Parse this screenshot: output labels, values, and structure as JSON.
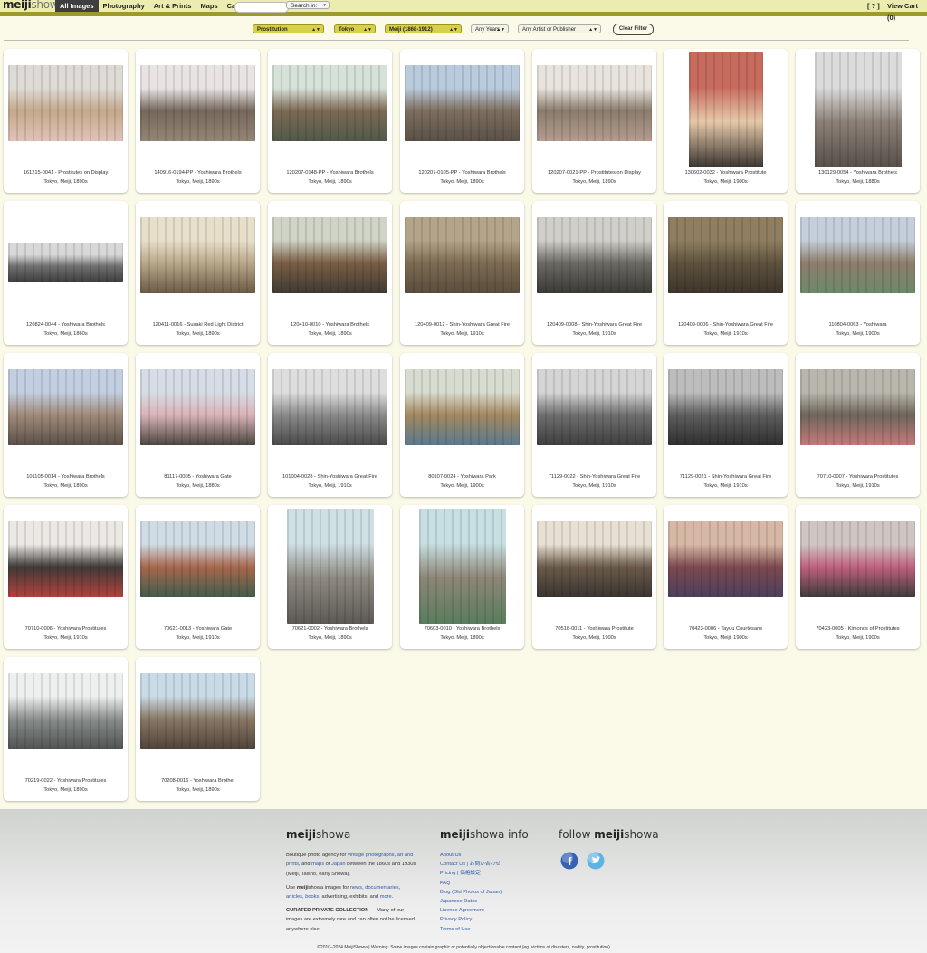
{
  "header": {
    "logo_part1": "meiji",
    "logo_part2": "showa",
    "nav": [
      "All Images",
      "Photography",
      "Art & Prints",
      "Maps",
      "Calendar"
    ],
    "search_placeholder": "",
    "search_button": "Search in:",
    "help": "[ ? ]",
    "cart": "View Cart (0)"
  },
  "filters": {
    "subject": "Prostitution",
    "place": "Tokyo",
    "era": "Meiji (1868-1912)",
    "years": "Any Years",
    "artist": "Any Artist or Publisher",
    "clear": "Clear Filter"
  },
  "images": [
    {
      "title": "161215-0041 - Prostitutes on Display",
      "sub": "Tokyo, Meiji, 1890s",
      "tone": [
        "#dedad6",
        "#c4a98b",
        "#e0c3b9"
      ]
    },
    {
      "title": "140916-0194-PP - Yoshiwara Brothels",
      "sub": "Tokyo, Meiji, 1890s",
      "tone": [
        "#e9e3e4",
        "#75685b",
        "#948675"
      ]
    },
    {
      "title": "120207-0148-PP - Yoshiwara Brothels",
      "sub": "Tokyo, Meiji, 1890s",
      "tone": [
        "#d6e1d8",
        "#7c6a53",
        "#505a4a"
      ]
    },
    {
      "title": "120207-0105-PP - Yoshiwara Brothels",
      "sub": "Tokyo, Meiji, 1890s",
      "tone": [
        "#b9cbdc",
        "#7d6e5f",
        "#595046"
      ]
    },
    {
      "title": "120207-0021-PP - Prostitutes on Display",
      "sub": "Tokyo, Meiji, 1890s",
      "tone": [
        "#e8e3dd",
        "#8a7c6c",
        "#b59c90"
      ]
    },
    {
      "title": "130602-0032 - Yoshiwara Prostitute",
      "sub": "Tokyo, Meiji, 1900s",
      "tone": [
        "#c76b5e",
        "#e6c8a8",
        "#3a3532"
      ]
    },
    {
      "title": "130129-0054 - Yoshiwara Brothels",
      "sub": "Tokyo, Meiji, 1880s",
      "tone": [
        "#dcdcdc",
        "#8c8178",
        "#575049"
      ]
    },
    {
      "title": "120824-0044 - Yoshiwara Brothels",
      "sub": "Tokyo, Meiji, 1860s",
      "tone": [
        "#d8d8d8",
        "#6f6f6f",
        "#3d3d3d"
      ]
    },
    {
      "title": "120411-0016 - Susaki Red Light District",
      "sub": "Tokyo, Meiji, 1890s",
      "tone": [
        "#e8dfcb",
        "#b9a88a",
        "#6b5a45"
      ]
    },
    {
      "title": "120410-0010 - Yoshiwara Brothels",
      "sub": "Tokyo, Meiji, 1890s",
      "tone": [
        "#cfd4c6",
        "#7a5e45",
        "#3f3a33"
      ]
    },
    {
      "title": "120409-0012 - Shin-Yoshiwara Great Fire",
      "sub": "Tokyo, Meiji, 1910s",
      "tone": [
        "#b4a58a",
        "#7d6b52",
        "#5a4d3c"
      ]
    },
    {
      "title": "120409-0008 - Shin-Yoshiwara Great Fire",
      "sub": "Tokyo, Meiji, 1910s",
      "tone": [
        "#d0cfca",
        "#6c6a64",
        "#3a3935"
      ]
    },
    {
      "title": "120409-0006 - Shin-Yoshiwara Great Fire",
      "sub": "Tokyo, Meiji, 1910s",
      "tone": [
        "#8f7e60",
        "#5e523f",
        "#3c3529"
      ]
    },
    {
      "title": "110804-0063 - Yoshiwara",
      "sub": "Tokyo, Meiji, 1900s",
      "tone": [
        "#c5cfdb",
        "#8e7d6d",
        "#6b8a6a"
      ]
    },
    {
      "title": "101105-0014 - Yoshiwara Brothels",
      "sub": "Tokyo, Meiji, 1890s",
      "tone": [
        "#c3cfe0",
        "#a08a7a",
        "#5a5048"
      ]
    },
    {
      "title": "81117-0005 - Yoshiwara Gate",
      "sub": "Tokyo, Meiji, 1880s",
      "tone": [
        "#d6dde6",
        "#d9b3b8",
        "#4a4640"
      ]
    },
    {
      "title": "101004-0028 - Shin-Yoshiwara Great Fire",
      "sub": "Tokyo, Meiji, 1910s",
      "tone": [
        "#dedede",
        "#8a8a8a",
        "#4a4a4a"
      ]
    },
    {
      "title": "80107-0024 - Yoshiwara Park",
      "sub": "Tokyo, Meiji, 1900s",
      "tone": [
        "#d8dbcf",
        "#a3885f",
        "#5b7a8e"
      ]
    },
    {
      "title": "71129-0022 - Shin-Yoshiwara Great Fire",
      "sub": "Tokyo, Meiji, 1910s",
      "tone": [
        "#d5d5d5",
        "#6f6f6f",
        "#3e3e3e"
      ]
    },
    {
      "title": "71129-0021 - Shin-Yoshiwara Great Fire",
      "sub": "Tokyo, Meiji, 1910s",
      "tone": [
        "#bdbdbd",
        "#5e5e5e",
        "#2e2e2e"
      ]
    },
    {
      "title": "70710-0007 - Yoshiwara Prostitutes",
      "sub": "Tokyo, Meiji, 1910s",
      "tone": [
        "#b9b6ad",
        "#6e665b",
        "#c47a7a"
      ]
    },
    {
      "title": "70710-0006 - Yoshiwara Prostitutes",
      "sub": "Tokyo, Meiji, 1910s",
      "tone": [
        "#ece8e4",
        "#3e3a37",
        "#b4423f"
      ]
    },
    {
      "title": "70621-0013 - Yoshiwara Gate",
      "sub": "Tokyo, Meiji, 1910s",
      "tone": [
        "#cfdbe5",
        "#a8674d",
        "#3f5d4a"
      ]
    },
    {
      "title": "70621-0002 - Yoshiwara Brothels",
      "sub": "Tokyo, Meiji, 1890s",
      "tone": [
        "#cfe0e5",
        "#8e8a82",
        "#5d5a55"
      ]
    },
    {
      "title": "70603-0010 - Yoshiwara Brothels",
      "sub": "Tokyo, Meiji, 1890s",
      "tone": [
        "#c7dfe2",
        "#8d8677",
        "#5a7d5d"
      ]
    },
    {
      "title": "70518-0011 - Yoshiwara Prostitute",
      "sub": "Tokyo, Meiji, 1900s",
      "tone": [
        "#e8e0d2",
        "#6a5a4a",
        "#3a3430"
      ]
    },
    {
      "title": "70423-0006 - Tayuu Courtesans",
      "sub": "Tokyo, Meiji, 1900s",
      "tone": [
        "#d7b8a6",
        "#7d4a4f",
        "#4b3e5d"
      ]
    },
    {
      "title": "70423-0005 - Kimonos of Prostitutes",
      "sub": "Tokyo, Meiji, 1900s",
      "tone": [
        "#cfc6c3",
        "#c0617f",
        "#3d3a3a"
      ]
    },
    {
      "title": "70219-0022 - Yoshiwara Prostitutes",
      "sub": "Tokyo, Meiji, 1890s",
      "tone": [
        "#eef0ef",
        "#8a8e8c",
        "#4e5250"
      ]
    },
    {
      "title": "70208-0016 - Yoshiwara Brothel",
      "sub": "Tokyo, Meiji, 1890s",
      "tone": [
        "#c9dbe6",
        "#8a7866",
        "#4f4338"
      ]
    }
  ],
  "footer": {
    "col1_title_bold": "meiji",
    "col1_title_rest": "showa",
    "col1_p1_a": "Boutique photo agency for ",
    "col1_p1_link1": "vintage photographs",
    "col1_p1_b": ", ",
    "col1_p1_link2": "art and prints",
    "col1_p1_c": ", and ",
    "col1_p1_link3": "maps",
    "col1_p1_d": " of ",
    "col1_p1_link4": "Japan",
    "col1_p1_e": " between the 1860s and 1930s (Meiji, Taisho, early Showa).",
    "col1_p2_a": "Use ",
    "col1_p2_bold": "meiji",
    "col1_p2_b": "showa images for ",
    "col1_p2_link1": "news",
    "col1_p2_c": ", ",
    "col1_p2_link2": "documentaries",
    "col1_p2_d": ", ",
    "col1_p2_link3": "articles",
    "col1_p2_e": ", ",
    "col1_p2_link4": "books",
    "col1_p2_f": ", advertising, exhibits, and ",
    "col1_p2_link5": "more",
    "col1_p2_g": ".",
    "col1_p3_bold": "CURATED PRIVATE COLLECTION",
    "col1_p3_rest": " — Many of our images are extremely rare and can often not be licensed anywhere else.",
    "col2_title_bold": "meiji",
    "col2_title_rest": "showa info",
    "col2_links": [
      "About Us",
      "Contact Us | お問い合わせ",
      "Pricing | 価格設定",
      "FAQ",
      "Blog (Old Photos of Japan)",
      "Japanese Dates",
      "License Agreement",
      "Privacy Policy",
      "Terms of Use"
    ],
    "col3_title_a": "follow ",
    "col3_title_bold": "meiji",
    "col3_title_rest": "showa",
    "facebook_color": "#3563b3",
    "twitter_color": "#5db2e6",
    "copyright": "©2010–2024 MeijiShowa | Warning: Some images contain graphic or potentially objectionable content (eg. victims of disasters, nudity, prostitution)"
  }
}
